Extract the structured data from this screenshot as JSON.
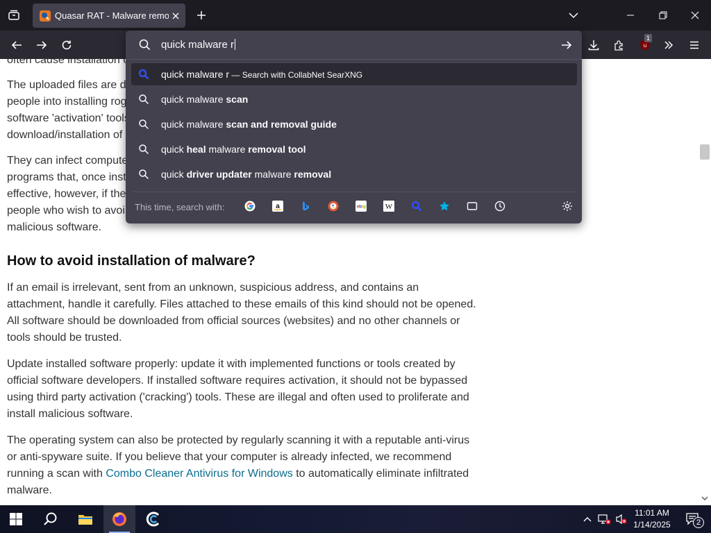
{
  "tabbar": {
    "tab_title": "Quasar RAT - Malware removal"
  },
  "urlbar": {
    "query": "quick malware r",
    "suggestions": [
      {
        "prefix": "quick malware r",
        "bold": "",
        "suffix": "",
        "engine_note": " — Search with CollabNet SearXNG"
      },
      {
        "prefix": "quick malware ",
        "bold": "scan",
        "suffix": ""
      },
      {
        "prefix": "quick malware ",
        "bold": "scan and removal guide",
        "suffix": ""
      },
      {
        "prefix": "quick ",
        "bold": "heal",
        "mid": " malware ",
        "bold2": "removal tool"
      },
      {
        "prefix": "quick ",
        "bold": "driver updater",
        "mid": " malware ",
        "bold2": "removal"
      }
    ],
    "oneoff_label": "This time, search with:",
    "oneoff_engines": [
      "google-icon",
      "amazon-icon",
      "bing-icon",
      "duckduckgo-icon",
      "ebay-icon",
      "wikipedia-icon",
      "searxng-icon",
      "bookmarks-icon",
      "tabs-icon",
      "history-icon"
    ]
  },
  "extensions": {
    "ublock_badge": "1"
  },
  "page": {
    "fragment_top": "often cause installation of",
    "p1_lines": [
      "The uploaded files are d",
      "people into installing rog",
      "software 'activation' tools",
      "download/installation of"
    ],
    "p2_lines": [
      "They can infect compute",
      "programs that, once inst",
      "effective, however, if the",
      "people who wish to avoi",
      "malicious software."
    ],
    "heading": "How to avoid installation of malware?",
    "p3_lines": [
      "If an email is irrelevant, sent from an unknown, suspicious address, and contains an",
      "attachment, handle it carefully. Files attached to these emails of this kind should not be opened.",
      "All software should be downloaded from official sources (websites) and no other channels or",
      "tools should be trusted."
    ],
    "p4_lines": [
      "Update installed software properly: update it with implemented functions or tools created by",
      "official software developers. If installed software requires activation, it should not be bypassed",
      "using third party activation ('cracking') tools. These are illegal and often used to proliferate and",
      "install malicious software."
    ],
    "p5_line1": "The operating system can also be protected by regularly scanning it with a reputable anti-virus",
    "p5_line2": "or anti-spyware suite. If you believe that your computer is already infected, we recommend",
    "p5_line3_before": "running a scan with ",
    "p5_link": "Combo Cleaner Antivirus for Windows",
    "p5_line3_after": " to automatically eliminate infiltrated",
    "p5_line4": "malware."
  },
  "taskbar": {
    "time": "11:01 AM",
    "date": "1/14/2025",
    "notification_count": "2"
  }
}
